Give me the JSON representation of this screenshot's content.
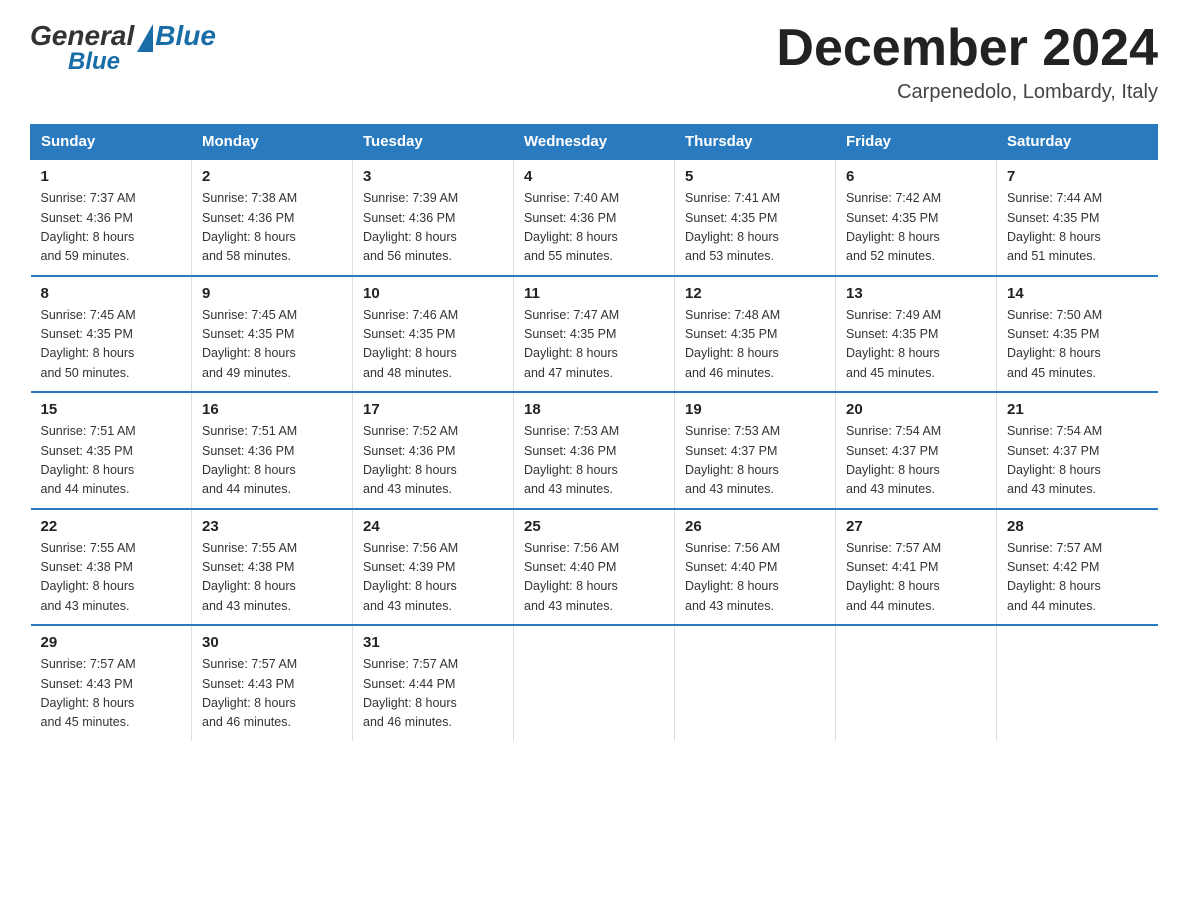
{
  "header": {
    "logo": {
      "general": "General",
      "blue": "Blue"
    },
    "title": "December 2024",
    "location": "Carpenedolo, Lombardy, Italy"
  },
  "weekdays": [
    "Sunday",
    "Monday",
    "Tuesday",
    "Wednesday",
    "Thursday",
    "Friday",
    "Saturday"
  ],
  "weeks": [
    [
      {
        "day": "1",
        "sunrise": "7:37 AM",
        "sunset": "4:36 PM",
        "daylight": "8 hours and 59 minutes."
      },
      {
        "day": "2",
        "sunrise": "7:38 AM",
        "sunset": "4:36 PM",
        "daylight": "8 hours and 58 minutes."
      },
      {
        "day": "3",
        "sunrise": "7:39 AM",
        "sunset": "4:36 PM",
        "daylight": "8 hours and 56 minutes."
      },
      {
        "day": "4",
        "sunrise": "7:40 AM",
        "sunset": "4:36 PM",
        "daylight": "8 hours and 55 minutes."
      },
      {
        "day": "5",
        "sunrise": "7:41 AM",
        "sunset": "4:35 PM",
        "daylight": "8 hours and 53 minutes."
      },
      {
        "day": "6",
        "sunrise": "7:42 AM",
        "sunset": "4:35 PM",
        "daylight": "8 hours and 52 minutes."
      },
      {
        "day": "7",
        "sunrise": "7:44 AM",
        "sunset": "4:35 PM",
        "daylight": "8 hours and 51 minutes."
      }
    ],
    [
      {
        "day": "8",
        "sunrise": "7:45 AM",
        "sunset": "4:35 PM",
        "daylight": "8 hours and 50 minutes."
      },
      {
        "day": "9",
        "sunrise": "7:45 AM",
        "sunset": "4:35 PM",
        "daylight": "8 hours and 49 minutes."
      },
      {
        "day": "10",
        "sunrise": "7:46 AM",
        "sunset": "4:35 PM",
        "daylight": "8 hours and 48 minutes."
      },
      {
        "day": "11",
        "sunrise": "7:47 AM",
        "sunset": "4:35 PM",
        "daylight": "8 hours and 47 minutes."
      },
      {
        "day": "12",
        "sunrise": "7:48 AM",
        "sunset": "4:35 PM",
        "daylight": "8 hours and 46 minutes."
      },
      {
        "day": "13",
        "sunrise": "7:49 AM",
        "sunset": "4:35 PM",
        "daylight": "8 hours and 45 minutes."
      },
      {
        "day": "14",
        "sunrise": "7:50 AM",
        "sunset": "4:35 PM",
        "daylight": "8 hours and 45 minutes."
      }
    ],
    [
      {
        "day": "15",
        "sunrise": "7:51 AM",
        "sunset": "4:35 PM",
        "daylight": "8 hours and 44 minutes."
      },
      {
        "day": "16",
        "sunrise": "7:51 AM",
        "sunset": "4:36 PM",
        "daylight": "8 hours and 44 minutes."
      },
      {
        "day": "17",
        "sunrise": "7:52 AM",
        "sunset": "4:36 PM",
        "daylight": "8 hours and 43 minutes."
      },
      {
        "day": "18",
        "sunrise": "7:53 AM",
        "sunset": "4:36 PM",
        "daylight": "8 hours and 43 minutes."
      },
      {
        "day": "19",
        "sunrise": "7:53 AM",
        "sunset": "4:37 PM",
        "daylight": "8 hours and 43 minutes."
      },
      {
        "day": "20",
        "sunrise": "7:54 AM",
        "sunset": "4:37 PM",
        "daylight": "8 hours and 43 minutes."
      },
      {
        "day": "21",
        "sunrise": "7:54 AM",
        "sunset": "4:37 PM",
        "daylight": "8 hours and 43 minutes."
      }
    ],
    [
      {
        "day": "22",
        "sunrise": "7:55 AM",
        "sunset": "4:38 PM",
        "daylight": "8 hours and 43 minutes."
      },
      {
        "day": "23",
        "sunrise": "7:55 AM",
        "sunset": "4:38 PM",
        "daylight": "8 hours and 43 minutes."
      },
      {
        "day": "24",
        "sunrise": "7:56 AM",
        "sunset": "4:39 PM",
        "daylight": "8 hours and 43 minutes."
      },
      {
        "day": "25",
        "sunrise": "7:56 AM",
        "sunset": "4:40 PM",
        "daylight": "8 hours and 43 minutes."
      },
      {
        "day": "26",
        "sunrise": "7:56 AM",
        "sunset": "4:40 PM",
        "daylight": "8 hours and 43 minutes."
      },
      {
        "day": "27",
        "sunrise": "7:57 AM",
        "sunset": "4:41 PM",
        "daylight": "8 hours and 44 minutes."
      },
      {
        "day": "28",
        "sunrise": "7:57 AM",
        "sunset": "4:42 PM",
        "daylight": "8 hours and 44 minutes."
      }
    ],
    [
      {
        "day": "29",
        "sunrise": "7:57 AM",
        "sunset": "4:43 PM",
        "daylight": "8 hours and 45 minutes."
      },
      {
        "day": "30",
        "sunrise": "7:57 AM",
        "sunset": "4:43 PM",
        "daylight": "8 hours and 46 minutes."
      },
      {
        "day": "31",
        "sunrise": "7:57 AM",
        "sunset": "4:44 PM",
        "daylight": "8 hours and 46 minutes."
      },
      null,
      null,
      null,
      null
    ]
  ],
  "labels": {
    "sunrise": "Sunrise:",
    "sunset": "Sunset:",
    "daylight": "Daylight:"
  }
}
